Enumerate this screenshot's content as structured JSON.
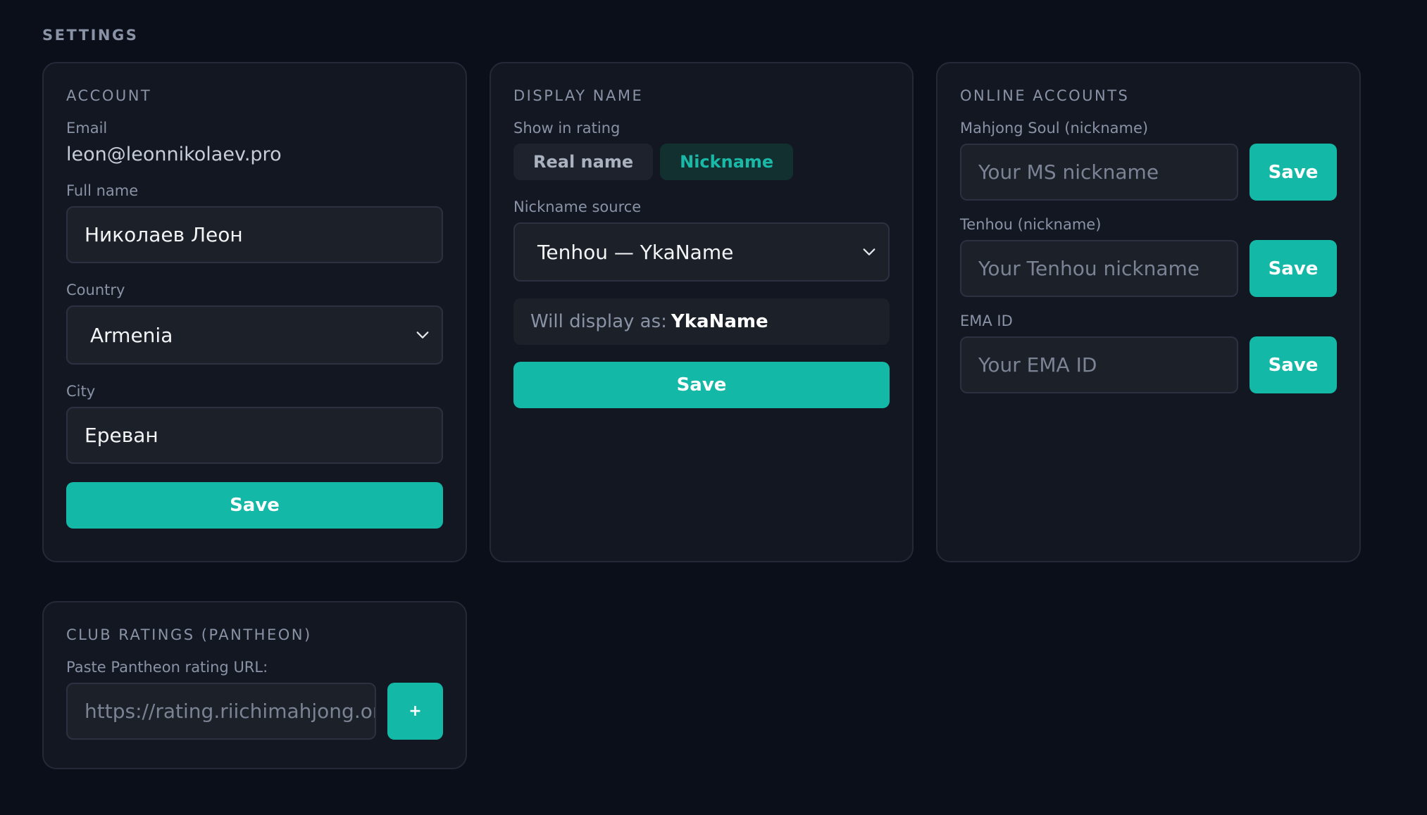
{
  "page": {
    "title": "SETTINGS"
  },
  "account": {
    "title": "ACCOUNT",
    "email_label": "Email",
    "email_value": "leon@leonnikolaev.pro",
    "fullname_label": "Full name",
    "fullname_value": "Николаев Леон",
    "country_label": "Country",
    "country_value": "Armenia",
    "city_label": "City",
    "city_value": "Ереван",
    "save_label": "Save"
  },
  "display_name": {
    "title": "DISPLAY NAME",
    "show_label": "Show in rating",
    "options": [
      "Real name",
      "Nickname"
    ],
    "selected_option": "Nickname",
    "source_label": "Nickname source",
    "source_value": "Tenhou — YkaName",
    "preview_prefix": "Will display as:",
    "preview_value": "YkaName",
    "save_label": "Save"
  },
  "online_accounts": {
    "title": "ONLINE ACCOUNTS",
    "fields": [
      {
        "label": "Mahjong Soul (nickname)",
        "placeholder": "Your MS nickname",
        "button": "Save"
      },
      {
        "label": "Tenhou (nickname)",
        "placeholder": "Your Tenhou nickname",
        "button": "Save"
      },
      {
        "label": "EMA ID",
        "placeholder": "Your EMA ID",
        "button": "Save"
      }
    ]
  },
  "club_ratings": {
    "title": "CLUB RATINGS (PANTHEON)",
    "url_label": "Paste Pantheon rating URL:",
    "url_placeholder": "https://rating.riichimahjong.org",
    "add_label": "+"
  },
  "colors": {
    "background": "#0b0f19",
    "card": "#131722",
    "accent": "#14b8a6",
    "muted_text": "#8a93a6"
  },
  "icons": [
    "chevron-down-icon",
    "plus-icon"
  ]
}
